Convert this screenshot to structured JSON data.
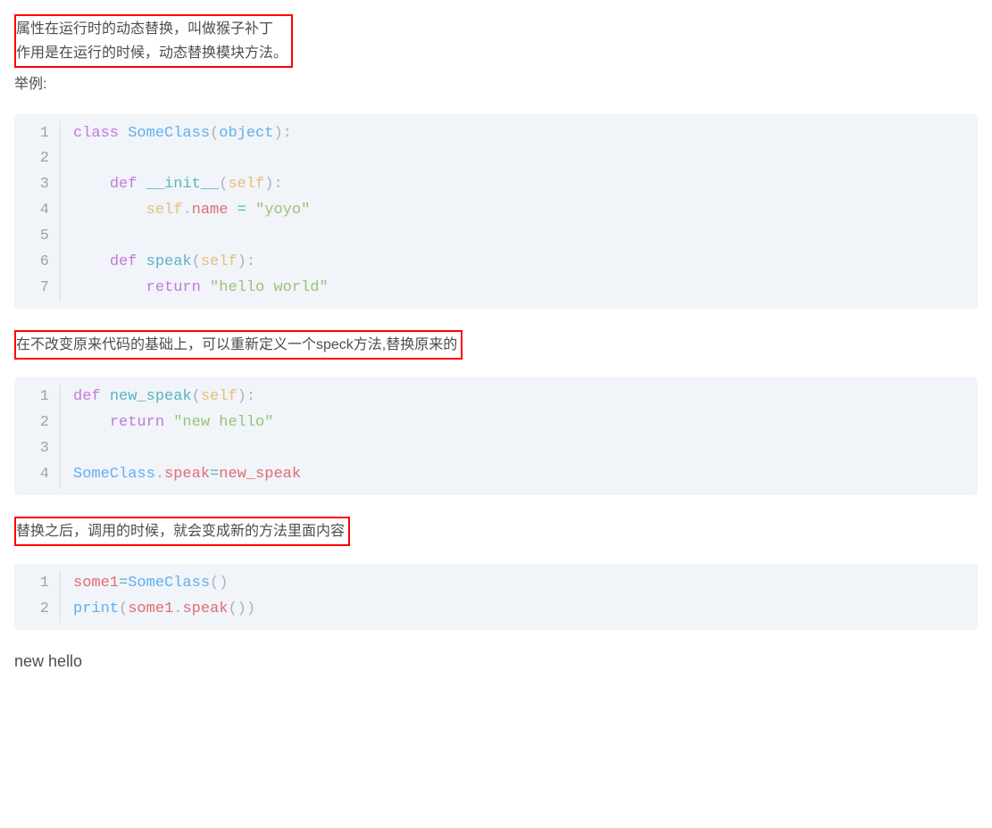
{
  "intro": {
    "line1": "属性在运行时的动态替换，叫做猴子补丁",
    "line2": "作用是在运行的时候，动态替换模块方法。"
  },
  "example_label": "举例:",
  "code1": {
    "lines": [
      {
        "n": "1",
        "t": [
          {
            "c": "kw",
            "v": "class"
          },
          {
            "c": "",
            "v": " "
          },
          {
            "c": "cls",
            "v": "SomeClass"
          },
          {
            "c": "pn",
            "v": "("
          },
          {
            "c": "cls",
            "v": "object"
          },
          {
            "c": "pn",
            "v": "):"
          }
        ]
      },
      {
        "n": "2",
        "t": []
      },
      {
        "n": "3",
        "t": [
          {
            "c": "",
            "v": "    "
          },
          {
            "c": "kw",
            "v": "def"
          },
          {
            "c": "",
            "v": " "
          },
          {
            "c": "sfn",
            "v": "__init__"
          },
          {
            "c": "pn",
            "v": "("
          },
          {
            "c": "self",
            "v": "self"
          },
          {
            "c": "pn",
            "v": "):"
          }
        ]
      },
      {
        "n": "4",
        "t": [
          {
            "c": "",
            "v": "        "
          },
          {
            "c": "self",
            "v": "self"
          },
          {
            "c": "pn",
            "v": "."
          },
          {
            "c": "attr",
            "v": "name"
          },
          {
            "c": "",
            "v": " "
          },
          {
            "c": "op",
            "v": "="
          },
          {
            "c": "",
            "v": " "
          },
          {
            "c": "str",
            "v": "\"yoyo\""
          }
        ]
      },
      {
        "n": "5",
        "t": []
      },
      {
        "n": "6",
        "t": [
          {
            "c": "",
            "v": "    "
          },
          {
            "c": "kw",
            "v": "def"
          },
          {
            "c": "",
            "v": " "
          },
          {
            "c": "fn",
            "v": "speak"
          },
          {
            "c": "pn",
            "v": "("
          },
          {
            "c": "self",
            "v": "self"
          },
          {
            "c": "pn",
            "v": "):"
          }
        ]
      },
      {
        "n": "7",
        "t": [
          {
            "c": "",
            "v": "        "
          },
          {
            "c": "kw",
            "v": "return"
          },
          {
            "c": "",
            "v": " "
          },
          {
            "c": "str",
            "v": "\"hello world\""
          }
        ]
      }
    ]
  },
  "mid_text": "在不改变原来代码的基础上，可以重新定义一个speck方法,替换原来的",
  "code2": {
    "lines": [
      {
        "n": "1",
        "t": [
          {
            "c": "kw",
            "v": "def"
          },
          {
            "c": "",
            "v": " "
          },
          {
            "c": "fn",
            "v": "new_speak"
          },
          {
            "c": "pn",
            "v": "("
          },
          {
            "c": "self",
            "v": "self"
          },
          {
            "c": "pn",
            "v": "):"
          }
        ]
      },
      {
        "n": "2",
        "t": [
          {
            "c": "",
            "v": "    "
          },
          {
            "c": "kw",
            "v": "return"
          },
          {
            "c": "",
            "v": " "
          },
          {
            "c": "str",
            "v": "\"new hello\""
          }
        ]
      },
      {
        "n": "3",
        "t": []
      },
      {
        "n": "4",
        "t": [
          {
            "c": "cls",
            "v": "SomeClass"
          },
          {
            "c": "pn",
            "v": "."
          },
          {
            "c": "attr",
            "v": "speak"
          },
          {
            "c": "op",
            "v": "="
          },
          {
            "c": "ident",
            "v": "new_speak"
          }
        ]
      }
    ]
  },
  "after_text": "替换之后，调用的时候，就会变成新的方法里面内容",
  "code3": {
    "lines": [
      {
        "n": "1",
        "t": [
          {
            "c": "ident",
            "v": "some1"
          },
          {
            "c": "op",
            "v": "="
          },
          {
            "c": "cls",
            "v": "SomeClass"
          },
          {
            "c": "pn",
            "v": "()"
          }
        ]
      },
      {
        "n": "2",
        "t": [
          {
            "c": "bi",
            "v": "print"
          },
          {
            "c": "pn",
            "v": "("
          },
          {
            "c": "ident",
            "v": "some1"
          },
          {
            "c": "pn",
            "v": "."
          },
          {
            "c": "attr",
            "v": "speak"
          },
          {
            "c": "pn",
            "v": "())"
          }
        ]
      }
    ]
  },
  "output": "new hello"
}
